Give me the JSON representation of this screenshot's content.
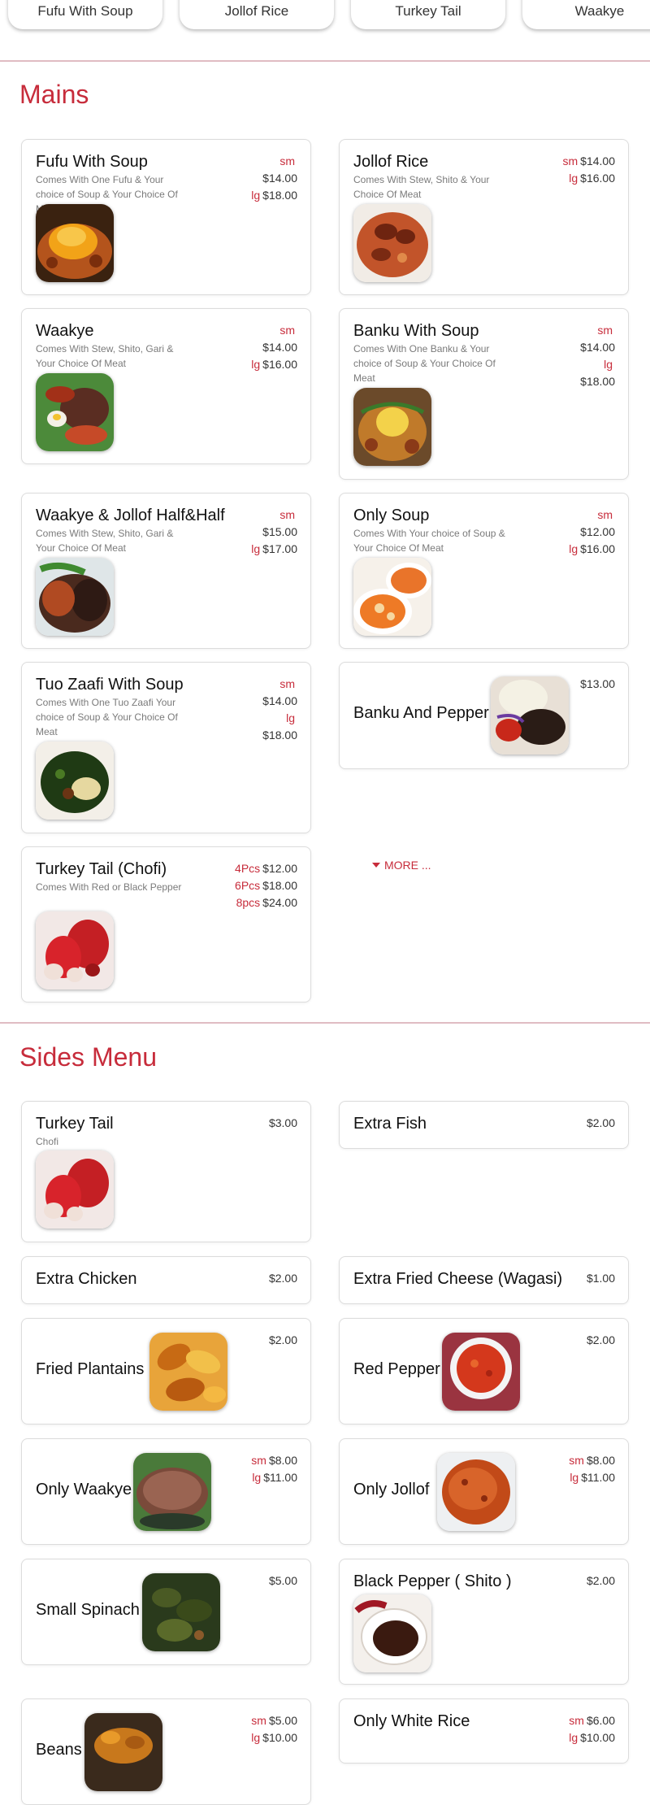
{
  "category_chips": [
    "Fufu With Soup",
    "Jollof Rice",
    "Turkey Tail",
    "Waakye"
  ],
  "mains": {
    "title": "Mains",
    "more_label": "MORE ...",
    "items": [
      {
        "name": "Fufu With Soup",
        "desc": "Comes With One Fufu & Your choice of Soup & Your Choice Of Meat",
        "prices": [
          {
            "size": "sm",
            "value": "$14.00"
          },
          {
            "size": "lg",
            "value": "$18.00"
          }
        ]
      },
      {
        "name": "Jollof Rice",
        "desc": "Comes With Stew, Shito & Your Choice Of Meat",
        "prices": [
          {
            "size": "sm",
            "value": "$14.00"
          },
          {
            "size": "lg",
            "value": "$16.00"
          }
        ]
      },
      {
        "name": "Waakye",
        "desc": "Comes With Stew, Shito, Gari & Your Choice Of Meat",
        "prices": [
          {
            "size": "sm",
            "value": "$14.00"
          },
          {
            "size": "lg",
            "value": "$16.00"
          }
        ]
      },
      {
        "name": "Banku With Soup",
        "desc": "Comes With One Banku & Your choice of Soup & Your Choice Of Meat",
        "prices": [
          {
            "size": "sm",
            "value": "$14.00"
          },
          {
            "size": "lg",
            "value": "$18.00"
          }
        ]
      },
      {
        "name": "Waakye & Jollof Half&Half",
        "desc": "Comes With Stew, Shito, Gari & Your Choice Of Meat",
        "prices": [
          {
            "size": "sm",
            "value": "$15.00"
          },
          {
            "size": "lg",
            "value": "$17.00"
          }
        ]
      },
      {
        "name": "Only Soup",
        "desc": "Comes With Your choice of Soup & Your Choice Of Meat",
        "prices": [
          {
            "size": "sm",
            "value": "$12.00"
          },
          {
            "size": "lg",
            "value": "$16.00"
          }
        ]
      },
      {
        "name": "Tuo Zaafi With Soup",
        "desc": "Comes With One Tuo Zaafi Your choice of Soup & Your Choice Of Meat",
        "prices": [
          {
            "size": "sm",
            "value": "$14.00"
          },
          {
            "size": "lg",
            "value": "$18.00"
          }
        ]
      },
      {
        "name": "Banku And Pepper",
        "desc": "",
        "prices": [
          {
            "size": "",
            "value": "$13.00"
          }
        ]
      },
      {
        "name": "Turkey Tail (Chofi)",
        "desc": "Comes With Red or Black Pepper",
        "prices": [
          {
            "size": "4Pcs",
            "value": "$12.00"
          },
          {
            "size": "6Pcs",
            "value": "$18.00"
          },
          {
            "size": "8pcs",
            "value": "$24.00"
          }
        ]
      }
    ]
  },
  "sides": {
    "title": "Sides Menu",
    "items": [
      {
        "name": "Turkey Tail",
        "desc": "Chofi",
        "prices": [
          {
            "size": "",
            "value": "$3.00"
          }
        ]
      },
      {
        "name": "Extra Fish",
        "desc": "",
        "prices": [
          {
            "size": "",
            "value": "$2.00"
          }
        ]
      },
      {
        "name": "Extra Chicken",
        "desc": "",
        "prices": [
          {
            "size": "",
            "value": "$2.00"
          }
        ]
      },
      {
        "name": "Extra Fried Cheese (Wagasi)",
        "desc": "",
        "prices": [
          {
            "size": "",
            "value": "$1.00"
          }
        ]
      },
      {
        "name": "Fried Plantains",
        "desc": "",
        "prices": [
          {
            "size": "",
            "value": "$2.00"
          }
        ]
      },
      {
        "name": "Red Pepper",
        "desc": "",
        "prices": [
          {
            "size": "",
            "value": "$2.00"
          }
        ]
      },
      {
        "name": "Only Waakye",
        "desc": "",
        "prices": [
          {
            "size": "sm",
            "value": "$8.00"
          },
          {
            "size": "lg",
            "value": "$11.00"
          }
        ]
      },
      {
        "name": "Only Jollof",
        "desc": "",
        "prices": [
          {
            "size": "sm",
            "value": "$8.00"
          },
          {
            "size": "lg",
            "value": "$11.00"
          }
        ]
      },
      {
        "name": "Small Spinach",
        "desc": "",
        "prices": [
          {
            "size": "",
            "value": "$5.00"
          }
        ]
      },
      {
        "name": "Black Pepper ( Shito )",
        "desc": "",
        "prices": [
          {
            "size": "",
            "value": "$2.00"
          }
        ]
      },
      {
        "name": "Beans",
        "desc": "",
        "prices": [
          {
            "size": "sm",
            "value": "$5.00"
          },
          {
            "size": "lg",
            "value": "$10.00"
          }
        ]
      },
      {
        "name": "Only White Rice",
        "desc": "",
        "prices": [
          {
            "size": "sm",
            "value": "$6.00"
          },
          {
            "size": "lg",
            "value": "$10.00"
          }
        ]
      }
    ]
  },
  "colors": {
    "accent": "#c72c3b",
    "divider": "#e0bcc3",
    "card_border": "#dcdcdc",
    "muted_text": "#7b7b7b"
  }
}
